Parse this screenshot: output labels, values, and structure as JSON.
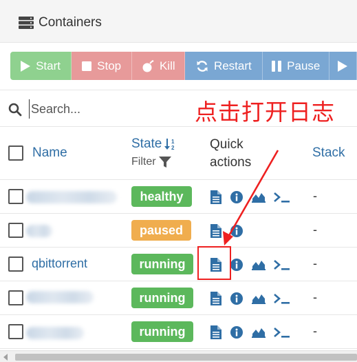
{
  "header": {
    "title": "Containers",
    "icon": "server-icon"
  },
  "toolbar": {
    "start": "Start",
    "stop": "Stop",
    "kill": "Kill",
    "restart": "Restart",
    "pause": "Pause"
  },
  "search": {
    "placeholder": "Search..."
  },
  "annotation": {
    "text": "点击打开日志"
  },
  "table": {
    "headers": {
      "name": "Name",
      "state": "State",
      "filter": "Filter",
      "quick_line1": "Quick",
      "quick_line2": "actions",
      "stack": "Stack"
    },
    "rows": [
      {
        "name": "",
        "state": "healthy",
        "stack": "-"
      },
      {
        "name": "",
        "state": "paused",
        "stack": "-"
      },
      {
        "name": "qbittorrent",
        "state": "running",
        "stack": "-"
      },
      {
        "name": "",
        "state": "running",
        "stack": "-"
      },
      {
        "name": "",
        "state": "running",
        "stack": "-"
      }
    ]
  },
  "colors": {
    "start": "#8fd18f",
    "danger": "#e79a9a",
    "primary": "#7aa7d3",
    "success": "#5cb85c",
    "warning": "#f0ad4e",
    "link": "#2f6ea5",
    "annotation": "#ee2020"
  }
}
